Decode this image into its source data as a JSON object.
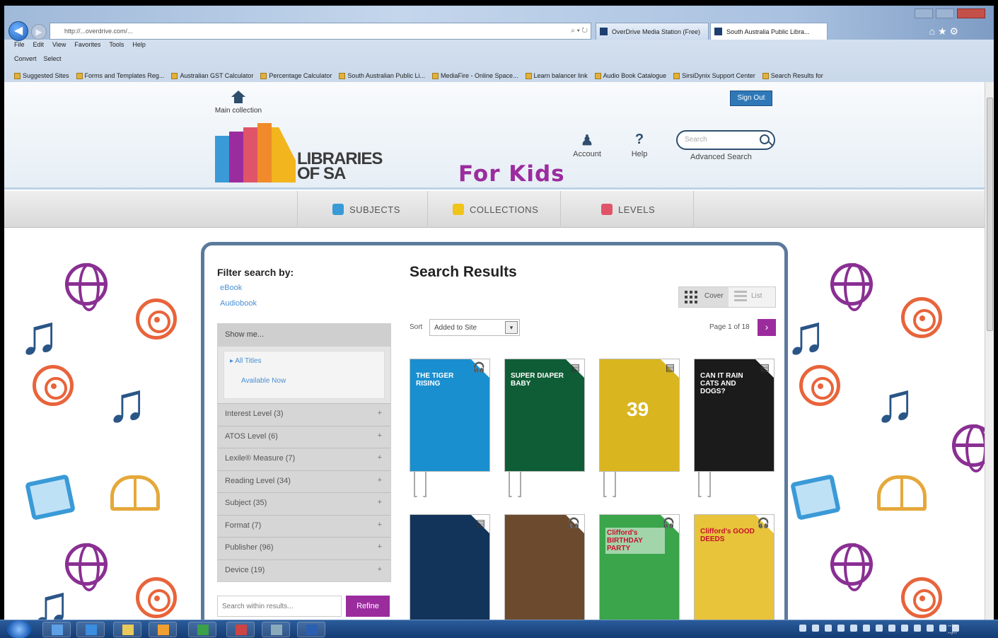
{
  "browser": {
    "address": "http://...overdrive.com/...",
    "tabs": [
      "OverDrive Media Station (Free)",
      "South Australia Public Libra..."
    ],
    "menu": [
      "File",
      "Edit",
      "View",
      "Favorites",
      "Tools",
      "Help"
    ],
    "commands": [
      "Convert",
      "Select"
    ],
    "favorites": [
      "Suggested Sites",
      "Forms and Templates Reg...",
      "Australian GST Calculator",
      "Percentage Calculator",
      "South Australian Public Li...",
      "MediaFire - Online Space...",
      "Learn balancer link",
      "Audio Book Catalogue",
      "SirsiDynix Support Center",
      "Search Results for"
    ]
  },
  "header": {
    "home_label": "Main collection",
    "logo_line1": "LIBRARIES",
    "logo_line2": "OF SA",
    "tagline": "For Kids",
    "account_label": "Account",
    "help_label": "Help",
    "search_placeholder": "Search",
    "advanced_search": "Advanced Search",
    "sign_out": "Sign Out"
  },
  "nav": [
    {
      "label": "SUBJECTS",
      "color": "#3a9ad7"
    },
    {
      "label": "COLLECTIONS",
      "color": "#f0c419"
    },
    {
      "label": "LEVELS",
      "color": "#e0546a"
    }
  ],
  "filter": {
    "title": "Filter search by:",
    "links": [
      "eBook",
      "Audiobook"
    ],
    "show_me": "Show me...",
    "all_titles": "All Titles",
    "available_now": "Available Now",
    "facets": [
      "Interest Level (3)",
      "ATOS Level (6)",
      "Lexile® Measure (7)",
      "Reading Level (34)",
      "Subject (35)",
      "Format (7)",
      "Publisher (96)",
      "Device (19)"
    ],
    "refine_placeholder": "Search within results...",
    "refine_button": "Refine"
  },
  "results": {
    "title": "Search Results",
    "view_cover": "Cover",
    "view_list": "List",
    "sort_label": "Sort",
    "sort_value": "Added to Site",
    "page_info": "Page 1 of 18",
    "next": "›",
    "books": [
      {
        "title": "THE TIGER RISING",
        "bg": "#1a8fcf",
        "badge": "headphones-icon"
      },
      {
        "title": "SUPER DIAPER BABY",
        "bg": "#0f5d36",
        "badge": "book-icon"
      },
      {
        "title": "39",
        "bg": "#d9b520",
        "badge": "book-icon"
      },
      {
        "title": "CAN IT RAIN CATS AND DOGS?",
        "bg": "#1b1b1b",
        "badge": "book-icon"
      },
      {
        "title": "",
        "bg": "#13345a",
        "badge": "book-icon"
      },
      {
        "title": "",
        "bg": "#6b4a2d",
        "badge": "headphones-icon"
      },
      {
        "title": "Clifford's BIRTHDAY PARTY",
        "bg": "#3aa54a",
        "badge": "headphones-icon"
      },
      {
        "title": "Clifford's GOOD DEEDS",
        "bg": "#e8c43a",
        "badge": "headphones-icon"
      }
    ]
  }
}
